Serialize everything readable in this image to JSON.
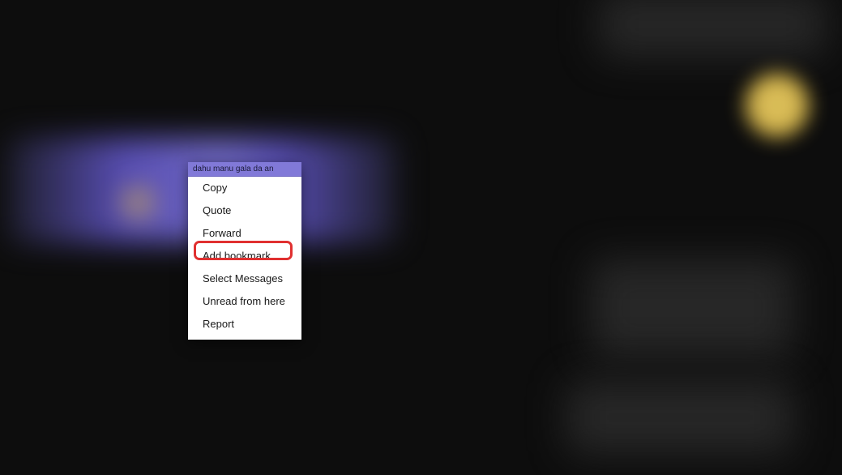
{
  "contextMenu": {
    "headerText": "dahu manu gala da an",
    "items": [
      {
        "label": "Copy"
      },
      {
        "label": "Quote"
      },
      {
        "label": "Forward"
      },
      {
        "label": "Add bookmark"
      },
      {
        "label": "Select Messages"
      },
      {
        "label": "Unread from here"
      },
      {
        "label": "Report"
      }
    ]
  }
}
